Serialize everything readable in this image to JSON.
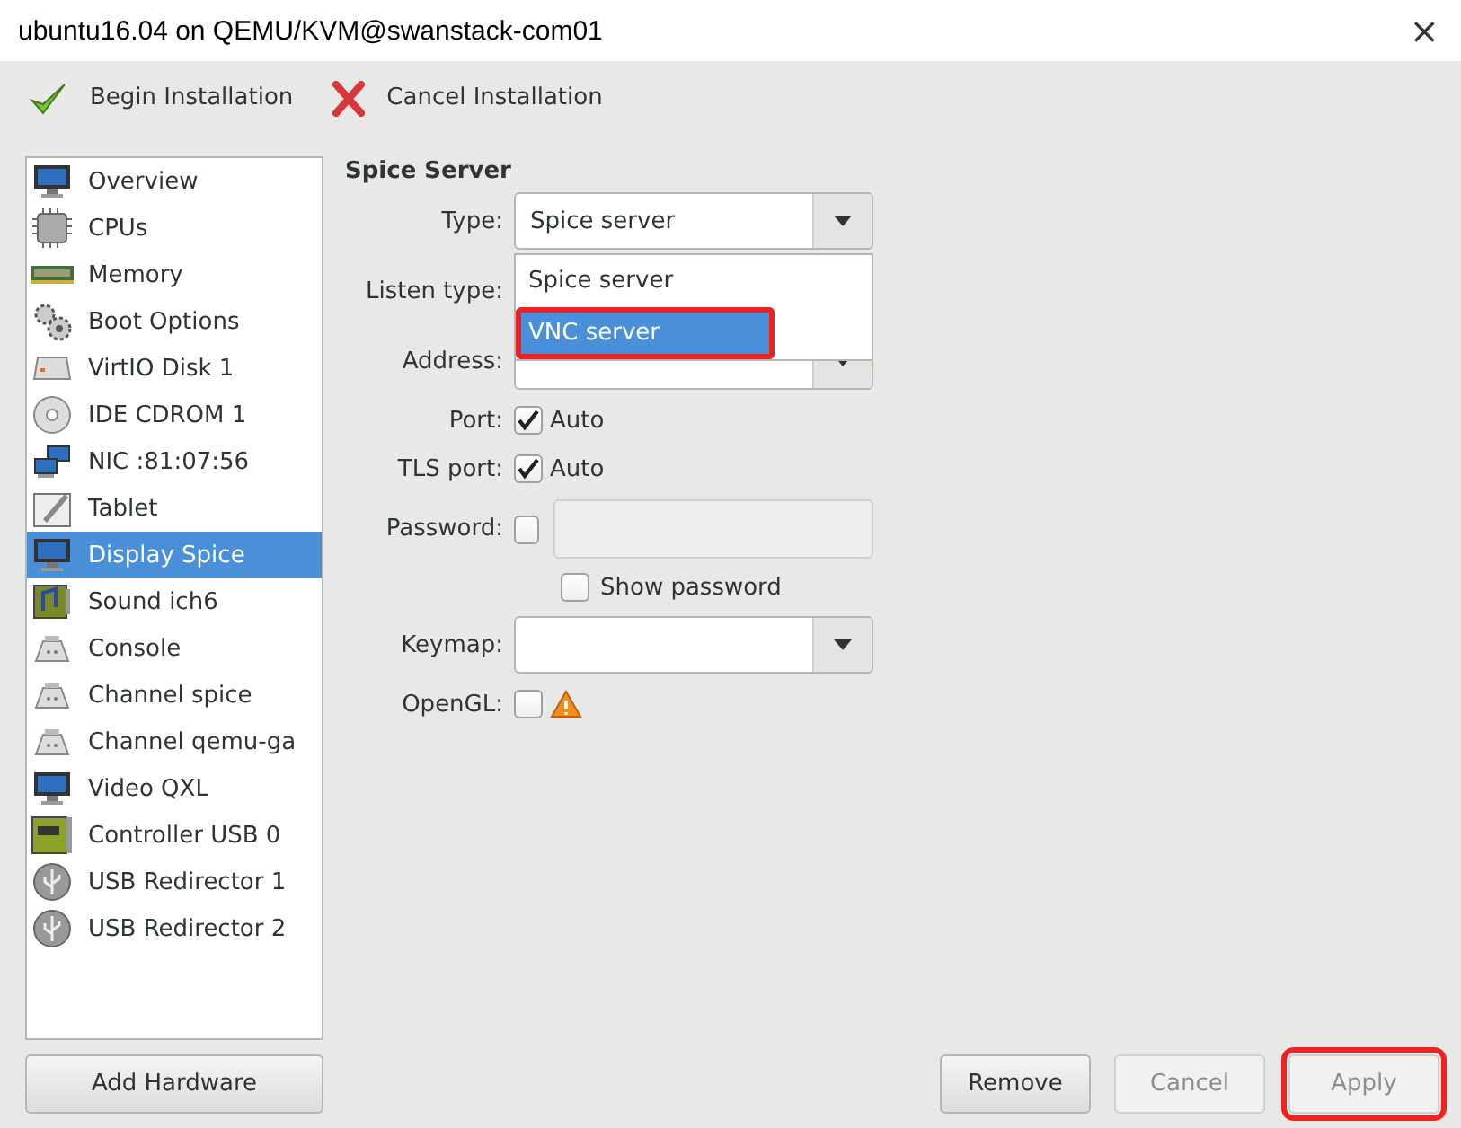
{
  "window": {
    "title": "ubuntu16.04 on QEMU/KVM@swanstack-com01",
    "close": "×"
  },
  "toolbar": [
    {
      "label": "Begin Installation",
      "kind": "check"
    },
    {
      "label": "Cancel Installation",
      "kind": "cross"
    }
  ],
  "sidebar": {
    "items": [
      {
        "label": "Overview",
        "kind": "monitor",
        "selected": false
      },
      {
        "label": "CPUs",
        "kind": "chip",
        "selected": false
      },
      {
        "label": "Memory",
        "kind": "memory",
        "selected": false
      },
      {
        "label": "Boot Options",
        "kind": "gears",
        "selected": false
      },
      {
        "label": "VirtIO Disk 1",
        "kind": "disk",
        "selected": false
      },
      {
        "label": "IDE CDROM 1",
        "kind": "cdrom",
        "selected": false
      },
      {
        "label": "NIC :81:07:56",
        "kind": "network",
        "selected": false
      },
      {
        "label": "Tablet",
        "kind": "tablet",
        "selected": false
      },
      {
        "label": "Display Spice",
        "kind": "monitor",
        "selected": true
      },
      {
        "label": "Sound ich6",
        "kind": "sound",
        "selected": false
      },
      {
        "label": "Console",
        "kind": "serial",
        "selected": false
      },
      {
        "label": "Channel spice",
        "kind": "serial",
        "selected": false
      },
      {
        "label": "Channel qemu-ga",
        "kind": "serial",
        "selected": false
      },
      {
        "label": "Video QXL",
        "kind": "monitor",
        "selected": false
      },
      {
        "label": "Controller USB 0",
        "kind": "card",
        "selected": false
      },
      {
        "label": "USB Redirector 1",
        "kind": "usb",
        "selected": false
      },
      {
        "label": "USB Redirector 2",
        "kind": "usb",
        "selected": false
      }
    ]
  },
  "add_hardware": "Add Hardware",
  "section_title": "Spice Server",
  "form": {
    "type": {
      "label": "Type:",
      "value": "Spice server",
      "options": [
        {
          "label": "Spice server",
          "highlighted": false,
          "annotated": false
        },
        {
          "label": "VNC server",
          "highlighted": true,
          "annotated": true
        }
      ]
    },
    "listen_type": {
      "label": "Listen type:"
    },
    "address": {
      "label": "Address:"
    },
    "port": {
      "label": "Port:",
      "checkbox": "Auto",
      "checked": true
    },
    "tls_port": {
      "label": "TLS port:",
      "checkbox": "Auto",
      "checked": true
    },
    "password": {
      "label": "Password:",
      "checked": false,
      "show_password": "Show password",
      "show_checked": false
    },
    "keymap": {
      "label": "Keymap:"
    },
    "opengl": {
      "label": "OpenGL:",
      "checked": false,
      "warning": true
    }
  },
  "buttons": [
    {
      "label": "Remove",
      "disabled": false,
      "annotated": false
    },
    {
      "label": "Cancel",
      "disabled": true,
      "annotated": false
    },
    {
      "label": "Apply",
      "disabled": true,
      "annotated": true
    }
  ]
}
